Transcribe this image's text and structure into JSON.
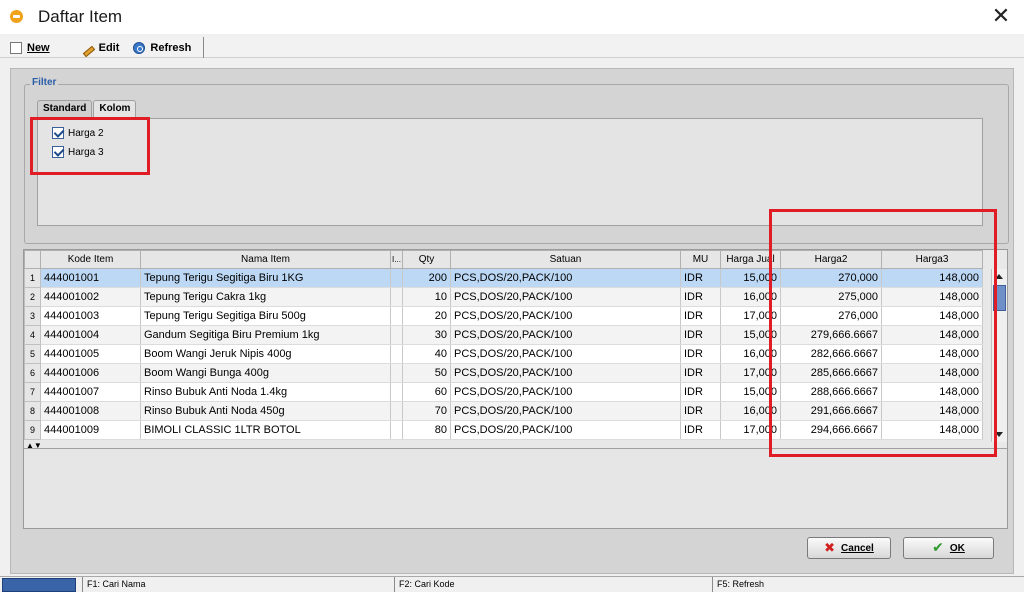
{
  "window": {
    "title": "Daftar Item",
    "close_glyph": "✕"
  },
  "toolbar": {
    "new_label": "New",
    "edit_label": "Edit",
    "refresh_label": "Refresh"
  },
  "filter": {
    "legend": "Filter",
    "tabs": [
      {
        "label": "Standard"
      },
      {
        "label": "Kolom"
      }
    ],
    "active_tab": "Kolom",
    "checkboxes": [
      {
        "label": "Harga 2",
        "checked": true
      },
      {
        "label": "Harga 3",
        "checked": true
      }
    ]
  },
  "grid": {
    "columns": [
      "Kode Item",
      "Nama Item",
      "I...",
      "Qty",
      "Satuan",
      "MU",
      "Harga Jual",
      "Harga2",
      "Harga3"
    ],
    "rows": [
      {
        "no": "1",
        "kode": "444001001",
        "nama": "Tepung Terigu Segitiga Biru 1KG",
        "i": "",
        "qty": "200",
        "satuan": "PCS,DOS/20,PACK/100",
        "mu": "IDR",
        "harga_jual": "15,000",
        "harga2": "270,000",
        "harga3": "148,000"
      },
      {
        "no": "2",
        "kode": "444001002",
        "nama": "Tepung Terigu Cakra 1kg",
        "i": "",
        "qty": "10",
        "satuan": "PCS,DOS/20,PACK/100",
        "mu": "IDR",
        "harga_jual": "16,000",
        "harga2": "275,000",
        "harga3": "148,000"
      },
      {
        "no": "3",
        "kode": "444001003",
        "nama": "Tepung Terigu Segitiga Biru 500g",
        "i": "",
        "qty": "20",
        "satuan": "PCS,DOS/20,PACK/100",
        "mu": "IDR",
        "harga_jual": "17,000",
        "harga2": "276,000",
        "harga3": "148,000"
      },
      {
        "no": "4",
        "kode": "444001004",
        "nama": "Gandum Segitiga Biru Premium 1kg",
        "i": "",
        "qty": "30",
        "satuan": "PCS,DOS/20,PACK/100",
        "mu": "IDR",
        "harga_jual": "15,000",
        "harga2": "279,666.6667",
        "harga3": "148,000"
      },
      {
        "no": "5",
        "kode": "444001005",
        "nama": "Boom Wangi Jeruk Nipis 400g",
        "i": "",
        "qty": "40",
        "satuan": "PCS,DOS/20,PACK/100",
        "mu": "IDR",
        "harga_jual": "16,000",
        "harga2": "282,666.6667",
        "harga3": "148,000"
      },
      {
        "no": "6",
        "kode": "444001006",
        "nama": "Boom Wangi Bunga 400g",
        "i": "",
        "qty": "50",
        "satuan": "PCS,DOS/20,PACK/100",
        "mu": "IDR",
        "harga_jual": "17,000",
        "harga2": "285,666.6667",
        "harga3": "148,000"
      },
      {
        "no": "7",
        "kode": "444001007",
        "nama": "Rinso Bubuk Anti Noda 1.4kg",
        "i": "",
        "qty": "60",
        "satuan": "PCS,DOS/20,PACK/100",
        "mu": "IDR",
        "harga_jual": "15,000",
        "harga2": "288,666.6667",
        "harga3": "148,000"
      },
      {
        "no": "8",
        "kode": "444001008",
        "nama": "Rinso Bubuk Anti Noda 450g",
        "i": "",
        "qty": "70",
        "satuan": "PCS,DOS/20,PACK/100",
        "mu": "IDR",
        "harga_jual": "16,000",
        "harga2": "291,666.6667",
        "harga3": "148,000"
      },
      {
        "no": "9",
        "kode": "444001009",
        "nama": "BIMOLI CLASSIC 1LTR BOTOL",
        "i": "",
        "qty": "80",
        "satuan": "PCS,DOS/20,PACK/100",
        "mu": "IDR",
        "harga_jual": "17,000",
        "harga2": "294,666.6667",
        "harga3": "148,000"
      }
    ],
    "selected_row": 1
  },
  "buttons": {
    "cancel_label": "Cancel",
    "ok_label": "OK"
  },
  "statusbar": {
    "f1": "F1: Cari Nama",
    "f2": "F2: Cari Kode",
    "f5": "F5: Refresh"
  },
  "colors": {
    "highlight_box": "#e01c24",
    "selected_row": "#bcd8f5",
    "accent": "#2a5ea8"
  }
}
